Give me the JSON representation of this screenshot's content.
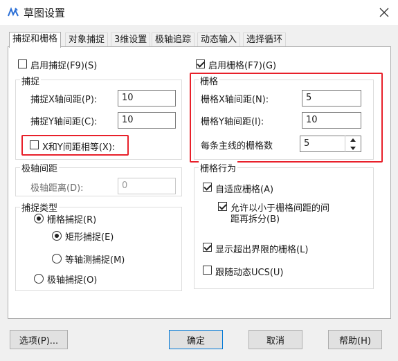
{
  "window": {
    "title": "草图设置",
    "icon": "app-icon"
  },
  "tabs": [
    "捕捉和栅格",
    "对象捕捉",
    "3维设置",
    "极轴追踪",
    "动态输入",
    "选择循环"
  ],
  "snap": {
    "enable_label": "启用捕捉(F9)(S)",
    "group_title": "捕捉",
    "x_label": "捕捉X轴间距(P):",
    "x_value": "10",
    "y_label": "捕捉Y轴间距(C):",
    "y_value": "10",
    "equal_label": "X和Y间距相等(X):"
  },
  "polar": {
    "group_title": "极轴间距",
    "distance_label": "极轴距离(D):",
    "distance_value": "0"
  },
  "snap_type": {
    "group_title": "捕捉类型",
    "grid_snap": "栅格捕捉(R)",
    "rect_snap": "矩形捕捉(E)",
    "iso_snap": "等轴测捕捉(M)",
    "polar_snap": "极轴捕捉(O)"
  },
  "grid": {
    "enable_label": "启用栅格(F7)(G)",
    "group_title": "栅格",
    "x_label": "栅格X轴间距(N):",
    "x_value": "5",
    "y_label": "栅格Y轴间距(I):",
    "y_value": "10",
    "major_label": "每条主线的栅格数",
    "major_value": "5"
  },
  "grid_behavior": {
    "group_title": "栅格行为",
    "adaptive": "自适应栅格(A)",
    "subdivide_line1": "允许以小于栅格间距的间",
    "subdivide_line2": "距再拆分(B)",
    "beyond_limits": "显示超出界限的栅格(L)",
    "follow_ucs": "跟随动态UCS(U)"
  },
  "buttons": {
    "options": "选项(P)...",
    "ok": "确定",
    "cancel": "取消",
    "help": "帮助(H)"
  },
  "colors": {
    "highlight": "#e8202a",
    "accent": "#0078d7"
  }
}
